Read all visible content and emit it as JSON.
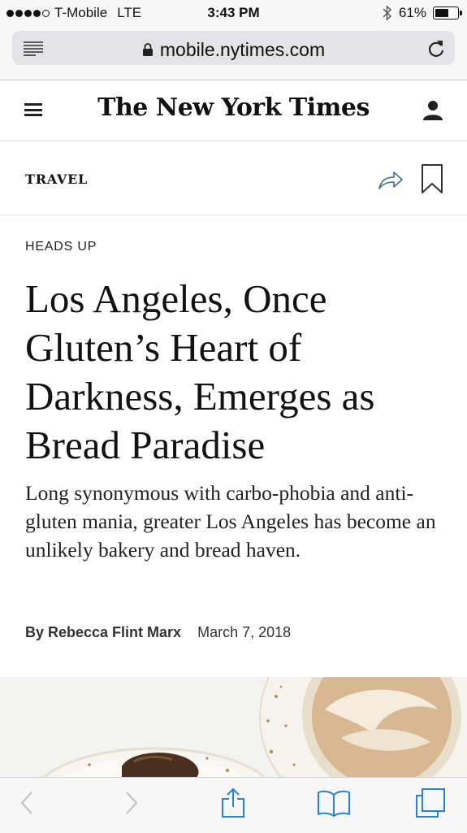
{
  "status_bar": {
    "carrier": "T-Mobile",
    "network": "LTE",
    "time": "3:43 PM",
    "battery_percent": "61%",
    "battery_level": 0.61
  },
  "browser": {
    "url": "mobile.nytimes.com"
  },
  "masthead": {
    "logo": "The New York Times"
  },
  "section": {
    "label": "TRAVEL"
  },
  "article": {
    "kicker": "HEADS UP",
    "headline": "Los Angeles, Once Gluten’s Heart of Darkness, Emerges as Bread Paradise",
    "summary": "Long synonymous with carbo-phobia and anti-gluten mania, greater Los Angeles has become an unlikely bakery and bread haven.",
    "author": "By Rebecca Flint Marx",
    "date": "March 7, 2018"
  },
  "colors": {
    "accent": "#2a80d2",
    "toolbar_bg": "#f7f7f7"
  },
  "icons": {
    "reader": "reader-view-icon",
    "lock": "lock-icon",
    "reload": "reload-icon",
    "menu": "hamburger-menu-icon",
    "user": "user-icon",
    "share_article": "share-arrow-icon",
    "save": "bookmark-icon",
    "back": "chevron-left-icon",
    "forward": "chevron-right-icon",
    "share": "share-icon",
    "bookmarks": "open-book-icon",
    "tabs": "tabs-icon"
  }
}
